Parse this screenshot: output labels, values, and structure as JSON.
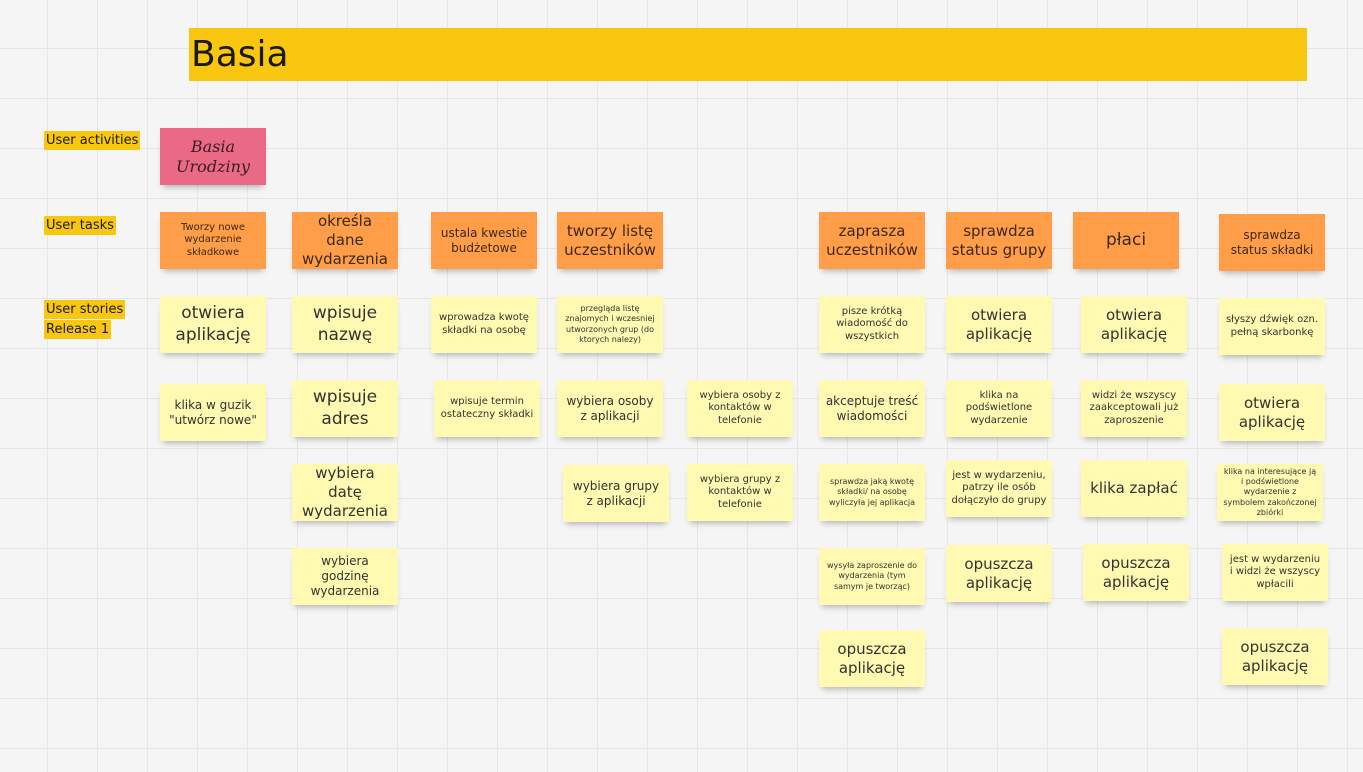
{
  "board": {
    "title": "Basia"
  },
  "row_labels": {
    "activities": "User activities",
    "tasks": "User tasks",
    "stories_line1": "User stories",
    "stories_line2": "Release 1"
  },
  "colors": {
    "banner": "#fac710",
    "activity": "#ea6a86",
    "task": "#ff9d48",
    "story": "#fff9b1"
  },
  "activity": {
    "text": "Basia Urodziny"
  },
  "tasks": [
    "Tworzy nowe wydarzenie składkowe",
    "określa dane wydarzenia",
    "ustala kwestie budżetowe",
    "tworzy listę uczestników",
    "zaprasza uczestników",
    "sprawdza status grupy",
    "płaci",
    "sprawdza status składki"
  ],
  "stories": {
    "col1": [
      "otwiera aplikację",
      "klika w guzik \"utwórz nowe\""
    ],
    "col2": [
      "wpisuje nazwę",
      "wpisuje adres",
      "wybiera datę wydarzenia",
      "wybiera godzinę wydarzenia"
    ],
    "col3": [
      "wprowadza kwotę składki na osobę",
      "wpisuje termin ostateczny składki"
    ],
    "col4": [
      "przegląda listę znajomych i wczesniej utworzonych grup (do ktorych nalezy)",
      "wybiera osoby z aplikacji",
      "wybiera grupy z aplikacji"
    ],
    "col4b": [
      "wybiera osoby z kontaktów w telefonie",
      "wybiera grupy z kontaktów w telefonie"
    ],
    "col5": [
      "pisze krótką wiadomość do wszystkich",
      "akceptuje treść wiadomości",
      "sprawdza jaką kwotę składki/ na osobę wyliczyła jej aplikacja",
      "wysyła zaproszenie do wydarzenia (tym samym je tworząc)",
      "opuszcza aplikację"
    ],
    "col6": [
      "otwiera aplikację",
      "klika na podświetlone wydarzenie",
      "jest w wydarzeniu, patrzy ile osób dołączyło do grupy",
      "opuszcza aplikację"
    ],
    "col7": [
      "otwiera aplikację",
      "widzi że wszyscy zaakceptowali już zaproszenie",
      "klika zapłać",
      "opuszcza aplikację"
    ],
    "col8": [
      "słyszy dźwięk ozn. pełną skarbonkę",
      "otwiera aplikację",
      "klika na interesujące ją i podświetlone wydarzenie z symbolem zakończonej zbiórki",
      "jest w wydarzeniu i widzi że wszyscy wpłacili",
      "opuszcza aplikację"
    ]
  }
}
